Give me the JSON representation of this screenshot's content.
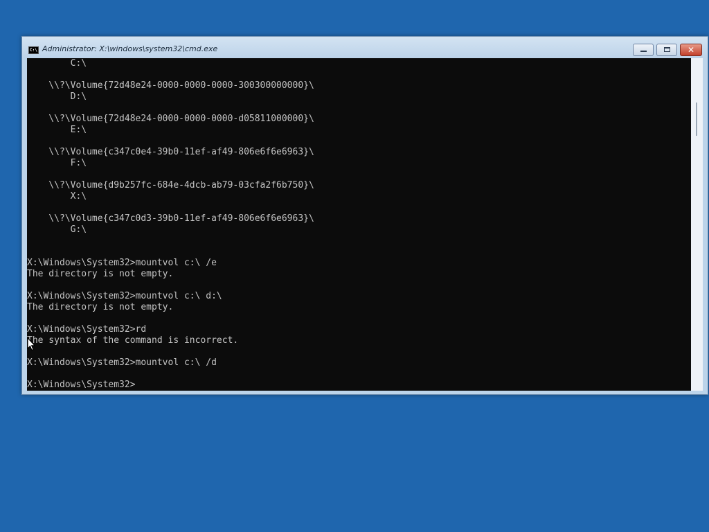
{
  "window": {
    "title": "Administrator: X:\\windows\\system32\\cmd.exe",
    "icon": "cmd-icon",
    "icon_text": "C:\\"
  },
  "controls": {
    "minimize": "minimize-icon",
    "maximize": "maximize-icon",
    "close": "close-icon",
    "close_glyph": "✕"
  },
  "console": {
    "lines": [
      "        C:\\",
      "",
      "    \\\\?\\Volume{72d48e24-0000-0000-0000-300300000000}\\",
      "        D:\\",
      "",
      "    \\\\?\\Volume{72d48e24-0000-0000-0000-d05811000000}\\",
      "        E:\\",
      "",
      "    \\\\?\\Volume{c347c0e4-39b0-11ef-af49-806e6f6e6963}\\",
      "        F:\\",
      "",
      "    \\\\?\\Volume{d9b257fc-684e-4dcb-ab79-03cfa2f6b750}\\",
      "        X:\\",
      "",
      "    \\\\?\\Volume{c347c0d3-39b0-11ef-af49-806e6f6e6963}\\",
      "        G:\\",
      "",
      "",
      "X:\\Windows\\System32>mountvol c:\\ /e",
      "The directory is not empty.",
      "",
      "X:\\Windows\\System32>mountvol c:\\ d:\\",
      "The directory is not empty.",
      "",
      "X:\\Windows\\System32>rd",
      "The syntax of the command is incorrect.",
      "",
      "X:\\Windows\\System32>mountvol c:\\ /d",
      "",
      "X:\\Windows\\System32>"
    ]
  },
  "colors": {
    "desktop": "#1f66ae",
    "console_bg": "#0c0c0c",
    "console_fg": "#c4c4c4"
  }
}
